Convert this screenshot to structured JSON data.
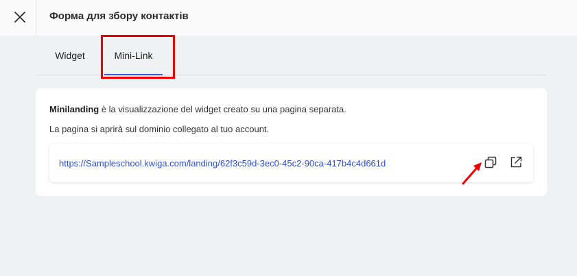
{
  "header": {
    "title": "Форма для збору контактів",
    "close_icon": "close-icon"
  },
  "tabs": [
    {
      "label": "Widget",
      "active": false
    },
    {
      "label": "Mini-Link",
      "active": true
    }
  ],
  "card": {
    "description_bold": "Minilanding",
    "description_rest": " è la visualizzazione del widget creato su una pagina separata.",
    "description_2": "La pagina si aprirà sul dominio collegato al tuo account.",
    "url": "https://Sampleschool.kwiga.com/landing/62f3c59d-3ec0-45c2-90ca-417b4c4d661d",
    "copy_icon": "copy-icon",
    "open_icon": "external-link-icon"
  },
  "colors": {
    "accent": "#3a57d6",
    "link": "#2d4fce",
    "annotation": "#ef0000",
    "background": "#eff2f3"
  }
}
